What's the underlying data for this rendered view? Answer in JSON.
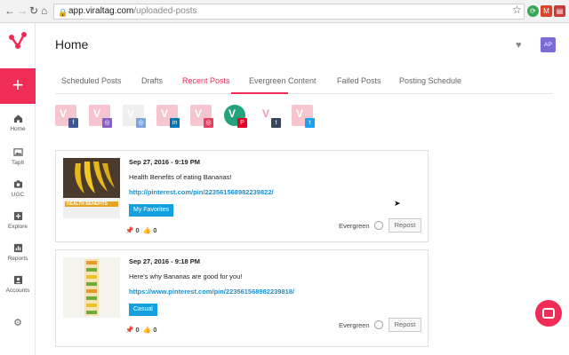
{
  "browser": {
    "url_host": "app.viraltag.com",
    "url_path": "/uploaded-posts"
  },
  "page": {
    "title": "Home"
  },
  "user": {
    "initials": "AP"
  },
  "sidebar": {
    "items": [
      {
        "label": "Home",
        "icon": "home-icon"
      },
      {
        "label": "TapIt",
        "icon": "image-icon"
      },
      {
        "label": "UGC",
        "icon": "camera-icon"
      },
      {
        "label": "Explore",
        "icon": "plus-square-icon"
      },
      {
        "label": "Reports",
        "icon": "bar-chart-icon"
      },
      {
        "label": "Accounts",
        "icon": "user-icon"
      }
    ]
  },
  "tabs": [
    {
      "label": "Scheduled Posts"
    },
    {
      "label": "Drafts"
    },
    {
      "label": "Recent Posts",
      "active": true
    },
    {
      "label": "Evergreen Content"
    },
    {
      "label": "Failed Posts"
    },
    {
      "label": "Posting Schedule"
    }
  ],
  "accounts": [
    {
      "network": "facebook",
      "color": "#3b5998",
      "glyph": "f"
    },
    {
      "network": "instagram",
      "color": "#8a5cc8",
      "glyph": "◎"
    },
    {
      "network": "instagram-business",
      "color": "#7aa6e0",
      "glyph": "◎"
    },
    {
      "network": "linkedin",
      "color": "#0077b5",
      "glyph": "in"
    },
    {
      "network": "instagram-pink",
      "color": "#e4405f",
      "glyph": "◎"
    },
    {
      "network": "pinterest",
      "color": "#e60023",
      "glyph": "P"
    },
    {
      "network": "tumblr",
      "color": "#35465c",
      "glyph": "t"
    },
    {
      "network": "twitter",
      "color": "#1da1f2",
      "glyph": "t"
    }
  ],
  "posts": [
    {
      "date": "Sep 27, 2016 - 9:19 PM",
      "text": "Health Benefits of eating Bananas!",
      "link": "http://pinterest.com/pin/223561568982239822/",
      "tag": "My Favorites",
      "pins": "0",
      "likes": "0",
      "evergreen_label": "Evergreen",
      "repost_label": "Repost",
      "thumb_caption": "HEALTH BENEFITS"
    },
    {
      "date": "Sep 27, 2016 - 9:18 PM",
      "text": "Here's why Bananas are good for you!",
      "link": "https://www.pinterest.com/pin/223561568982239818/",
      "tag": "Casual",
      "pins": "0",
      "likes": "0",
      "evergreen_label": "Evergreen",
      "repost_label": "Repost"
    }
  ],
  "colors": {
    "brand": "#ef2d56",
    "link": "#1a8fd0",
    "tag": "#14a0df"
  }
}
